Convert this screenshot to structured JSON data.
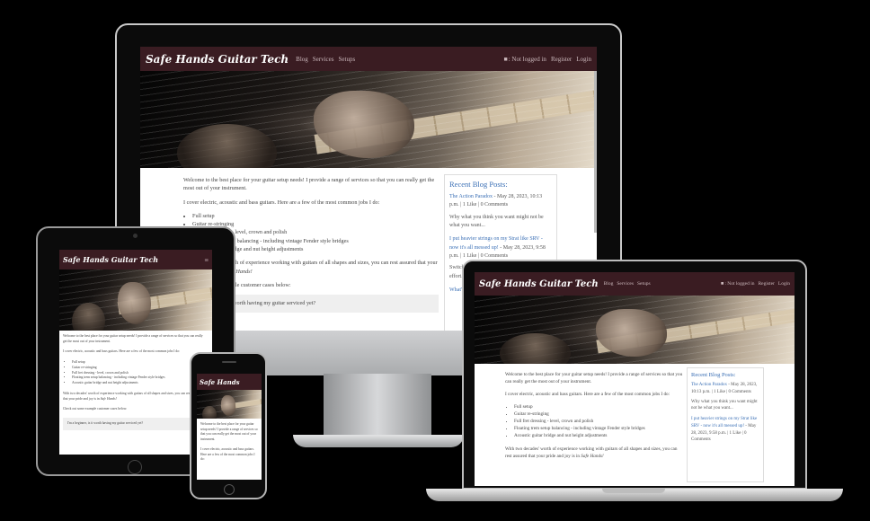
{
  "site": {
    "brand": "Safe Hands Guitar Tech",
    "brand_short": "Safe Hands",
    "nav": [
      "Blog",
      "Services",
      "Setups"
    ],
    "user_status": ": Not logged in",
    "register": "Register",
    "login": "Login",
    "menu_icon": "≡"
  },
  "main": {
    "intro": "Welcome to the best place for your guitar setup needs! I provide a range of services so that you can really get the most out of your instrument.",
    "cover": "I cover electric, acoustic and bass guitars. Here are a few of the most common jobs I do:",
    "jobs": [
      "Full setup",
      "Guitar re-stringing",
      "Full fret dressing - level, crown and polish",
      "Floating trem setup balancing - including vintage Fender style bridges",
      "Acoustic guitar bridge and nut height adjustments"
    ],
    "experience_a": "With two decades' worth of experience working with guitars of all shapes and sizes, you can rest assured that your pride and joy is in",
    "experience_b": "Safe Hands!",
    "check": "Check out some example customer cases below:",
    "faq": "I'm a beginner, is it worth having my guitar serviced yet?"
  },
  "blog": {
    "title": "Recent Blog Posts:",
    "posts": [
      {
        "title": "The Action Paradox",
        "meta": "- May 28, 2023, 10:13 p.m. | 1 Like | 0 Comments",
        "excerpt": "Why what you think you want might not be what you want..."
      },
      {
        "title": "I put heavier strings on my Strat like SRV - now it's all messed up!",
        "meta": "- May 28, 2023, 9:58 p.m. | 1 Like | 0 Comments",
        "excerpt": "Switching to heavier strings can be a big effort..."
      },
      {
        "title": "What's",
        "meta": "",
        "excerpt": ""
      }
    ]
  }
}
